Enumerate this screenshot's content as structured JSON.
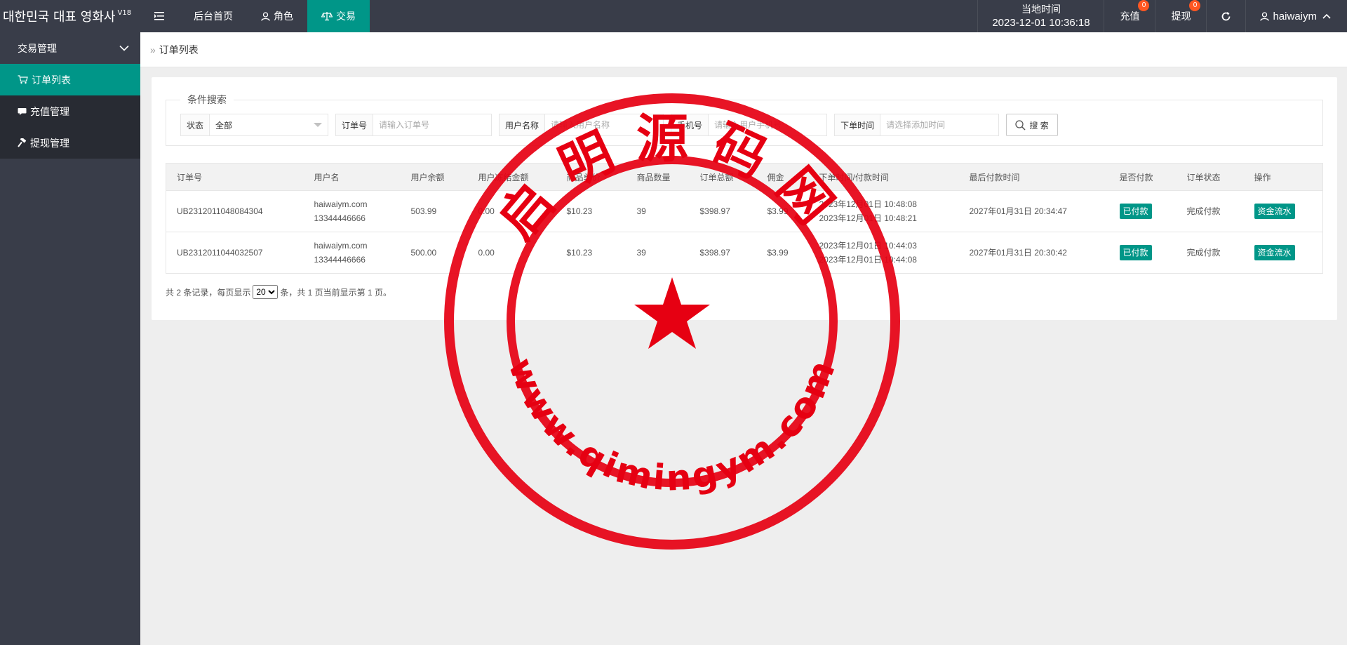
{
  "header": {
    "brand": "대한민국 대표 영화사",
    "brand_version": "V18",
    "nav": [
      {
        "label": "后台首页",
        "icon": "",
        "active": false
      },
      {
        "label": "角色",
        "icon": "user-icon",
        "active": false
      },
      {
        "label": "交易",
        "icon": "scale-icon",
        "active": true
      }
    ],
    "clock_label": "当地时间",
    "clock_value": "2023-12-01 10:36:18",
    "recharge_label": "充值",
    "recharge_badge": "0",
    "withdraw_label": "提现",
    "withdraw_badge": "0",
    "username": "haiwaiym"
  },
  "sidebar": {
    "group_label": "交易管理",
    "items": [
      {
        "label": "订单列表",
        "icon": "cart-icon",
        "active": true
      },
      {
        "label": "充值管理",
        "icon": "comment-icon",
        "active": false
      },
      {
        "label": "提现管理",
        "icon": "hammer-icon",
        "active": false
      }
    ]
  },
  "breadcrumb": "订单列表",
  "search": {
    "legend": "条件搜索",
    "status_label": "状态",
    "status_value": "全部",
    "order_label": "订单号",
    "order_placeholder": "请输入订单号",
    "username_label": "用户名称",
    "username_placeholder": "请输入用户名称",
    "phone_label": "手机号",
    "phone_placeholder": "请输入用户手机号",
    "time_label": "下单时间",
    "time_placeholder": "请选择添加时间",
    "button": "搜 索"
  },
  "table": {
    "headers": [
      "订单号",
      "用户名",
      "用户余额",
      "用户冻结金额",
      "商品单价",
      "商品数量",
      "订单总额",
      "佣金",
      "下单时间/付款时间",
      "最后付款时间",
      "是否付款",
      "订单状态",
      "操作"
    ],
    "rows": [
      {
        "order_no": "UB2312011048084304",
        "username": "haiwaiym.com",
        "phone": "13344446666",
        "balance": "503.99",
        "frozen": "0.00",
        "price": "$10.23",
        "qty": "39",
        "total": "$398.97",
        "commission": "$3.99",
        "created": "2023年12月01日 10:48:08",
        "paid": "2023年12月01日 10:48:21",
        "last_pay": "2027年01月31日 20:34:47",
        "pay_status": "已付款",
        "order_status": "完成付款",
        "action": "资金流水"
      },
      {
        "order_no": "UB2312011044032507",
        "username": "haiwaiym.com",
        "phone": "13344446666",
        "balance": "500.00",
        "frozen": "0.00",
        "price": "$10.23",
        "qty": "39",
        "total": "$398.97",
        "commission": "$3.99",
        "created": "2023年12月01日 10:44:03",
        "paid": "2023年12月01日 10:44:08",
        "last_pay": "2027年01月31日 20:30:42",
        "pay_status": "已付款",
        "order_status": "完成付款",
        "action": "资金流水"
      }
    ]
  },
  "pager": {
    "prefix": "共 2 条记录，每页显示",
    "page_size": "20",
    "suffix": "条，共 1 页当前显示第 1 页。"
  },
  "watermark": {
    "top_text": "启明源码网",
    "bottom_text": "www.qimingym.com",
    "color": "#e60012"
  }
}
